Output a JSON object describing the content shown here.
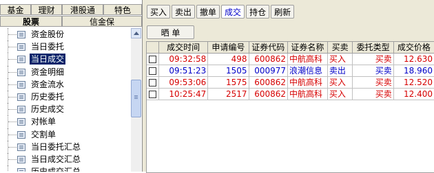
{
  "left_tabs_row1": [
    "基金",
    "理财",
    "港股通",
    "特色"
  ],
  "left_tabs_row2": [
    "股票",
    "信金保"
  ],
  "tree_items": [
    "资金股份",
    "当日委托",
    "当日成交",
    "资金明细",
    "资金流水",
    "历史委托",
    "历史成交",
    "对帐单",
    "交割单",
    "当日委托汇总",
    "当日成交汇总",
    "历史成交汇总"
  ],
  "selected_tree_item": "当日成交",
  "toolbar": [
    "买入",
    "卖出",
    "撤单",
    "成交",
    "持仓",
    "刷新"
  ],
  "active_toolbar": "成交",
  "subbar_label": "晒 单",
  "columns": [
    "",
    "成交时间",
    "申请编号",
    "证券代码",
    "证券名称",
    "买卖",
    "委托类型",
    "成交价格"
  ],
  "rows": [
    {
      "time": "09:32:58",
      "id": "498",
      "code": "600862",
      "name": "中航高科",
      "side": "买入",
      "type": "买卖",
      "price": "12.630",
      "kind": "buy"
    },
    {
      "time": "09:51:23",
      "id": "1505",
      "code": "000977",
      "name": "浪潮信息",
      "side": "卖出",
      "type": "买卖",
      "price": "18.960",
      "kind": "sell"
    },
    {
      "time": "09:53:06",
      "id": "1575",
      "code": "600862",
      "name": "中航高科",
      "side": "买入",
      "type": "买卖",
      "price": "12.520",
      "kind": "buy"
    },
    {
      "time": "10:25:47",
      "id": "2517",
      "code": "600862",
      "name": "中航高科",
      "side": "买入",
      "type": "买卖",
      "price": "12.400",
      "kind": "buy"
    }
  ]
}
